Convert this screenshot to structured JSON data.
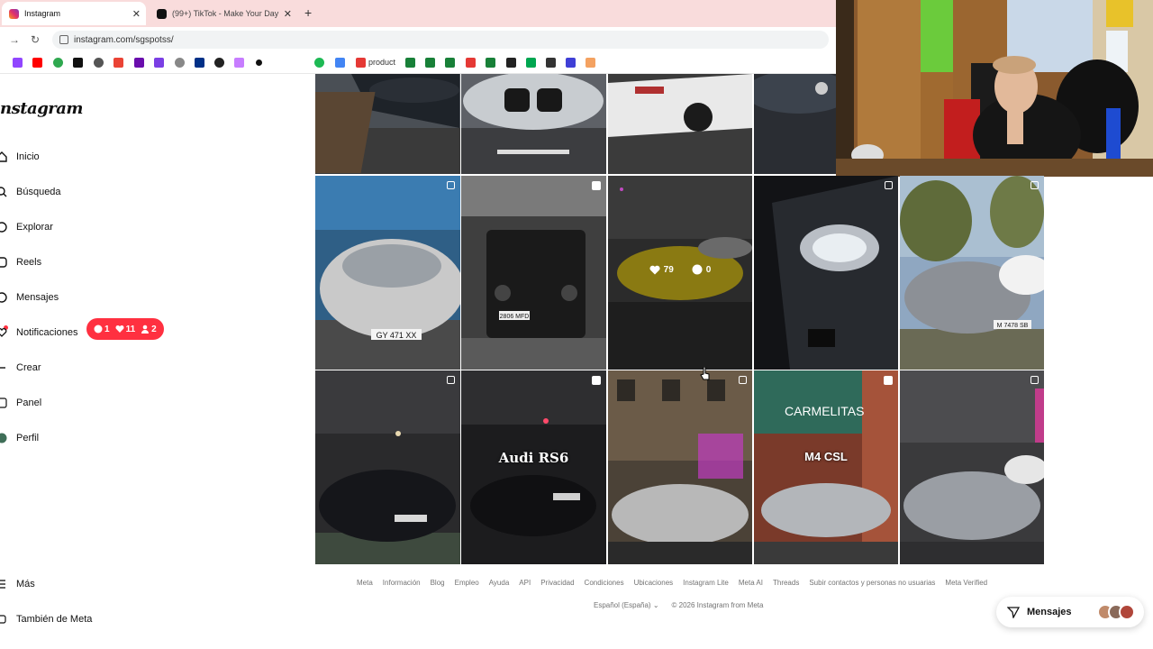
{
  "browser": {
    "tabs": [
      {
        "title": "Instagram",
        "active": true
      },
      {
        "title": "(99+) TikTok - Make Your Day",
        "active": false
      }
    ],
    "new_tab": "+",
    "url": "instagram.com/sgspotss/",
    "bookmark_label": "product"
  },
  "sidebar": {
    "logo": "nstagram",
    "items": [
      {
        "label": "Inicio",
        "icon": "home-icon"
      },
      {
        "label": "Búsqueda",
        "icon": "search-icon"
      },
      {
        "label": "Explorar",
        "icon": "compass-icon"
      },
      {
        "label": "Reels",
        "icon": "reels-icon"
      },
      {
        "label": "Mensajes",
        "icon": "messenger-icon"
      },
      {
        "label": "Notificaciones",
        "icon": "heart-icon"
      },
      {
        "label": "Crear",
        "icon": "plus-icon"
      },
      {
        "label": "Panel",
        "icon": "dashboard-icon"
      },
      {
        "label": "Perfil",
        "icon": "avatar-icon"
      },
      {
        "label": "Más",
        "icon": "menu-icon"
      },
      {
        "label": "También de Meta",
        "icon": "meta-icon"
      }
    ],
    "notifications_pill": {
      "comments": "1",
      "likes": "11",
      "follows": "2"
    }
  },
  "grid": {
    "hover_stats": {
      "likes": "79",
      "comments": "0"
    },
    "overlay_texts": {
      "audi": "Audi RS6",
      "bmw": "M4 CSL",
      "sign": "CARMELITAS"
    },
    "plates": {
      "ferrari": "GY 471 XX",
      "gclass": "2806 MFD",
      "porsche911": "M 7478 SB",
      "rs6": "2704 MFG"
    }
  },
  "footer": {
    "links": [
      "Meta",
      "Información",
      "Blog",
      "Empleo",
      "Ayuda",
      "API",
      "Privacidad",
      "Condiciones",
      "Ubicaciones",
      "Instagram Lite",
      "Meta AI",
      "Threads",
      "Subir contactos y personas no usuarias",
      "Meta Verified"
    ],
    "language": "Español (España)",
    "copyright": "© 2026 Instagram from Meta"
  },
  "messages_button": {
    "label": "Mensajes"
  },
  "colors": {
    "accent_red": "#ff3040",
    "tab_strip": "#f9dcdc",
    "footer_text": "#737373"
  }
}
